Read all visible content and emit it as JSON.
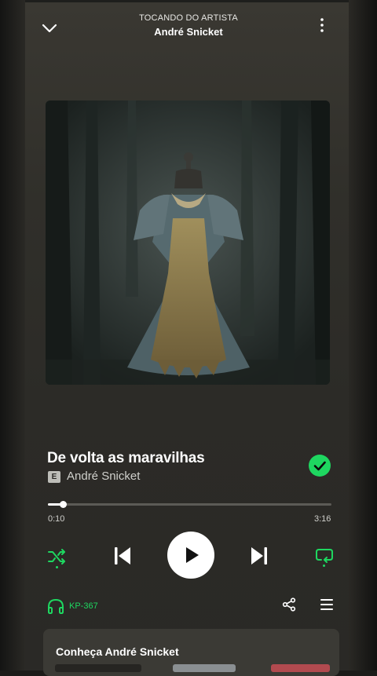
{
  "header": {
    "context_label": "TOCANDO DO ARTISTA",
    "context_name": "André Snicket",
    "collapse_icon": "chevron-down-icon",
    "menu_icon": "more-vertical-icon"
  },
  "track": {
    "title": "De volta as maravilhas",
    "explicit_badge": "E",
    "artist": "André Snicket",
    "liked": true,
    "progress_fraction": 0.054,
    "elapsed": "0:10",
    "duration": "3:16"
  },
  "controls": {
    "shuffle_active": true,
    "repeat_active": true,
    "state": "paused"
  },
  "footer": {
    "device_name": "KP-367",
    "device_icon": "headphones-icon",
    "share_icon": "share-icon",
    "queue_icon": "queue-icon"
  },
  "artist_card": {
    "title": "Conheça André Snicket"
  },
  "colors": {
    "accent": "#1ed760",
    "background": "#2c2b27",
    "card": "#3b3a35"
  }
}
